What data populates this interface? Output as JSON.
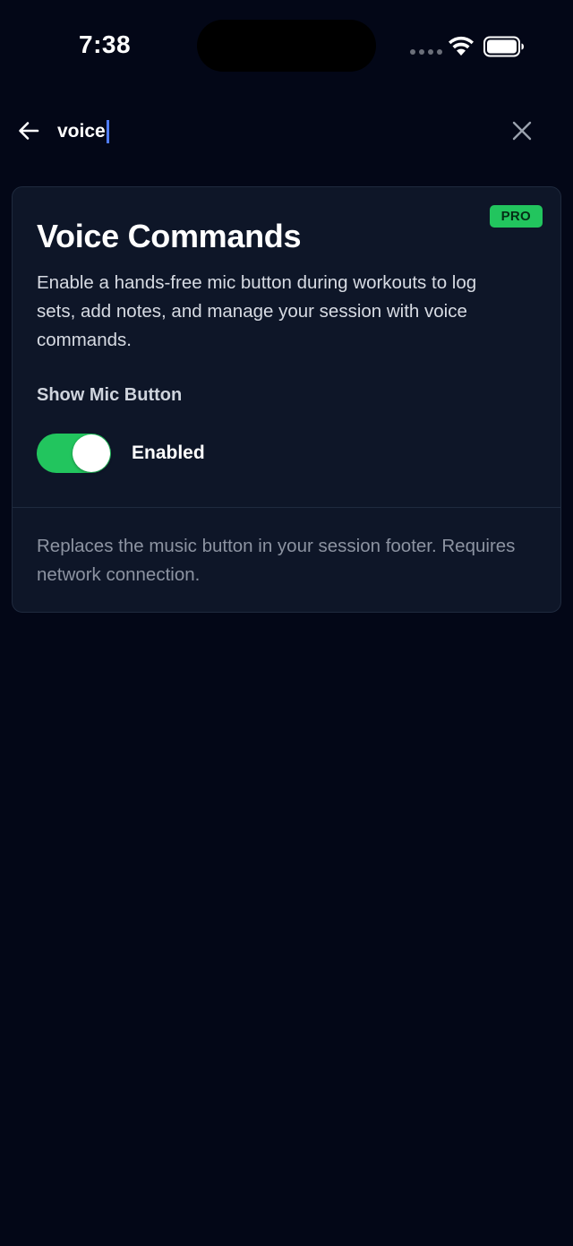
{
  "status_bar": {
    "time": "7:38"
  },
  "search": {
    "query": "voice",
    "back_icon": "arrow-left-icon",
    "clear_icon": "close-icon"
  },
  "card": {
    "badge": "PRO",
    "title": "Voice Commands",
    "description": "Enable a hands-free mic button during workouts to log sets, add notes, and manage your session with voice commands.",
    "setting_label": "Show Mic Button",
    "toggle_on": true,
    "toggle_status": "Enabled",
    "footnote": "Replaces the music button in your session footer. Requires network connection."
  },
  "colors": {
    "background": "#030717",
    "card": "#0e1628",
    "accent_green": "#22c55e",
    "caret": "#4f7cff"
  }
}
